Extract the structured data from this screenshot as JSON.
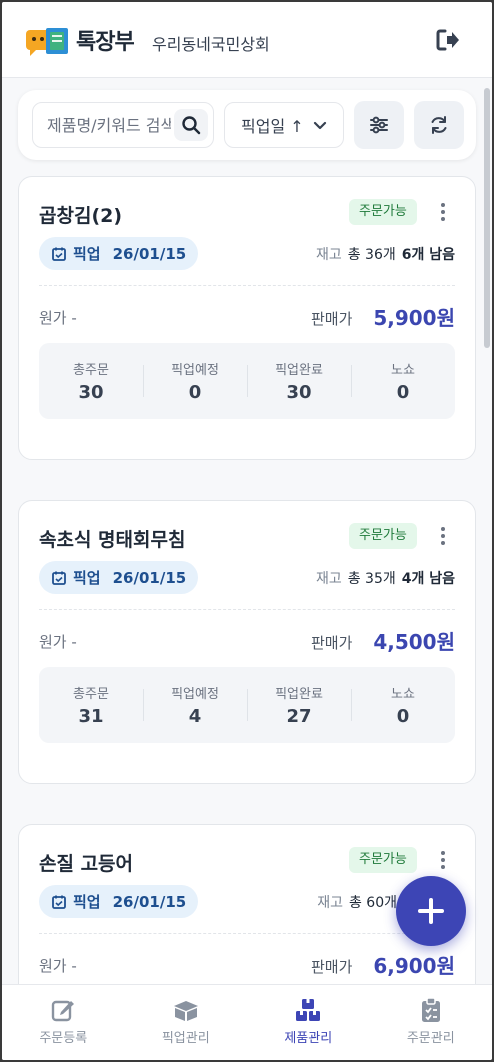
{
  "header": {
    "app_name": "톡장부",
    "store_name": "우리동네국민상회"
  },
  "filter": {
    "search_placeholder": "제품명/키워드 검색",
    "sort_label": "픽업일 ↑"
  },
  "stock_label": "재고",
  "cost_label": "원가",
  "price_label": "판매가",
  "pickup_label": "픽업",
  "stat_labels": [
    "총주문",
    "픽업예정",
    "픽업완료",
    "노쇼"
  ],
  "products": [
    {
      "name": "곱창김(2)",
      "status": "주문가능",
      "pickup_date": "26/01/15",
      "stock_total": "총 36개",
      "stock_remaining": "6개 남음",
      "cost": "-",
      "price": "5,900원",
      "stats": [
        "30",
        "0",
        "30",
        "0"
      ]
    },
    {
      "name": "속초식 명태회무침",
      "status": "주문가능",
      "pickup_date": "26/01/15",
      "stock_total": "총 35개",
      "stock_remaining": "4개 남음",
      "cost": "-",
      "price": "4,500원",
      "stats": [
        "31",
        "4",
        "27",
        "0"
      ]
    },
    {
      "name": "손질 고등어",
      "status": "주문가능",
      "pickup_date": "26/01/15",
      "stock_total": "총 60개",
      "stock_remaining": "",
      "cost": "-",
      "price": "6,900원",
      "stats": [
        "",
        "",
        "",
        ""
      ]
    }
  ],
  "bottom_nav": [
    {
      "label": "주문등록",
      "icon": "edit-icon"
    },
    {
      "label": "픽업관리",
      "icon": "box-icon"
    },
    {
      "label": "제품관리",
      "icon": "boxes-icon",
      "active": true
    },
    {
      "label": "주문관리",
      "icon": "clipboard-icon"
    }
  ],
  "colors": {
    "accent": "#3d45b5",
    "status_green_bg": "#e4f7ea",
    "pickup_bg": "#e6f1fb"
  }
}
